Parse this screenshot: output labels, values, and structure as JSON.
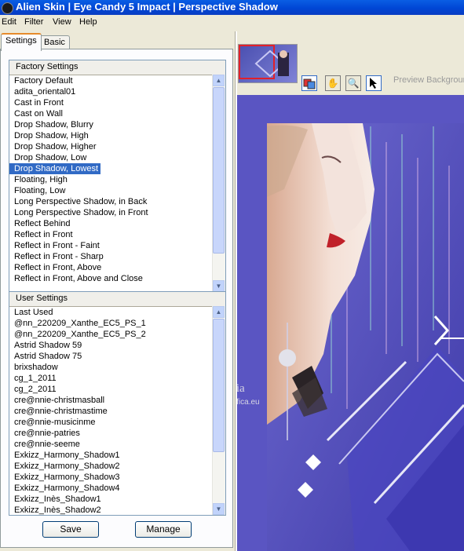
{
  "window": {
    "title": "Alien Skin | Eye Candy 5 Impact | Perspective Shadow"
  },
  "menu": [
    "Edit",
    "Filter",
    "View",
    "Help"
  ],
  "tabs": [
    "Settings",
    "Basic"
  ],
  "factory": {
    "header": "Factory Settings",
    "items": [
      "Factory Default",
      "adita_oriental01",
      "Cast in Front",
      "Cast on Wall",
      "Drop Shadow, Blurry",
      "Drop Shadow, High",
      "Drop Shadow, Higher",
      "Drop Shadow, Low",
      "Drop Shadow, Lowest",
      "Floating, High",
      "Floating, Low",
      "Long Perspective Shadow, in Back",
      "Long Perspective Shadow, in Front",
      "Reflect Behind",
      "Reflect in Front",
      "Reflect in Front - Faint",
      "Reflect in Front - Sharp",
      "Reflect in Front, Above",
      "Reflect in Front, Above and Close"
    ],
    "selected": "Drop Shadow, Lowest"
  },
  "user": {
    "header": "User Settings",
    "items": [
      "Last Used",
      "@nn_220209_Xanthe_EC5_PS_1",
      "@nn_220209_Xanthe_EC5_PS_2",
      "Astrid Shadow 59",
      "Astrid Shadow 75",
      "brixshadow",
      "cg_1_2011",
      "cg_2_2011",
      "cre@nnie-christmasball",
      "cre@nnie-christmastime",
      "cre@nnie-musicinme",
      "cre@nnie-patries",
      "cre@nnie-seeme",
      "Exkizz_Harmony_Shadow1",
      "Exkizz_Harmony_Shadow2",
      "Exkizz_Harmony_Shadow3",
      "Exkizz_Harmony_Shadow4",
      "Exkizz_Inès_Shadow1",
      "Exkizz_Inès_Shadow2"
    ]
  },
  "buttons": {
    "save": "Save",
    "manage": "Manage"
  },
  "preview": {
    "label": "Preview Background",
    "watermark_1": "Pinuccia",
    "watermark_2": "www.maidiregrafica.eu"
  },
  "tools": [
    "preview-toggle-icon",
    "hand-icon",
    "zoom-icon",
    "arrow-pointer-icon"
  ],
  "colors": {
    "titlebar": "#0054e3",
    "selection": "#316ac5",
    "preview_bg": "#5c57c4"
  }
}
